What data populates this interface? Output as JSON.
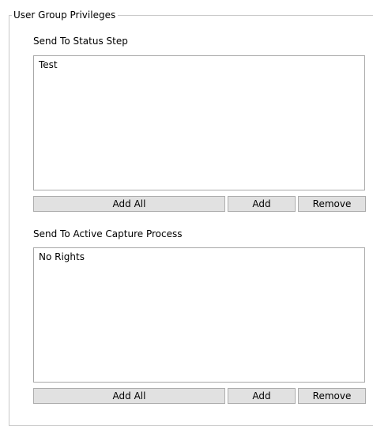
{
  "group": {
    "title": "User Group Privileges"
  },
  "sections": [
    {
      "label": "Send To Status Step",
      "items": [
        "Test"
      ],
      "buttons": {
        "add_all": "Add All",
        "add": "Add",
        "remove": "Remove"
      }
    },
    {
      "label": "Send To Active Capture Process",
      "items": [
        "No Rights"
      ],
      "buttons": {
        "add_all": "Add All",
        "add": "Add",
        "remove": "Remove"
      }
    }
  ]
}
